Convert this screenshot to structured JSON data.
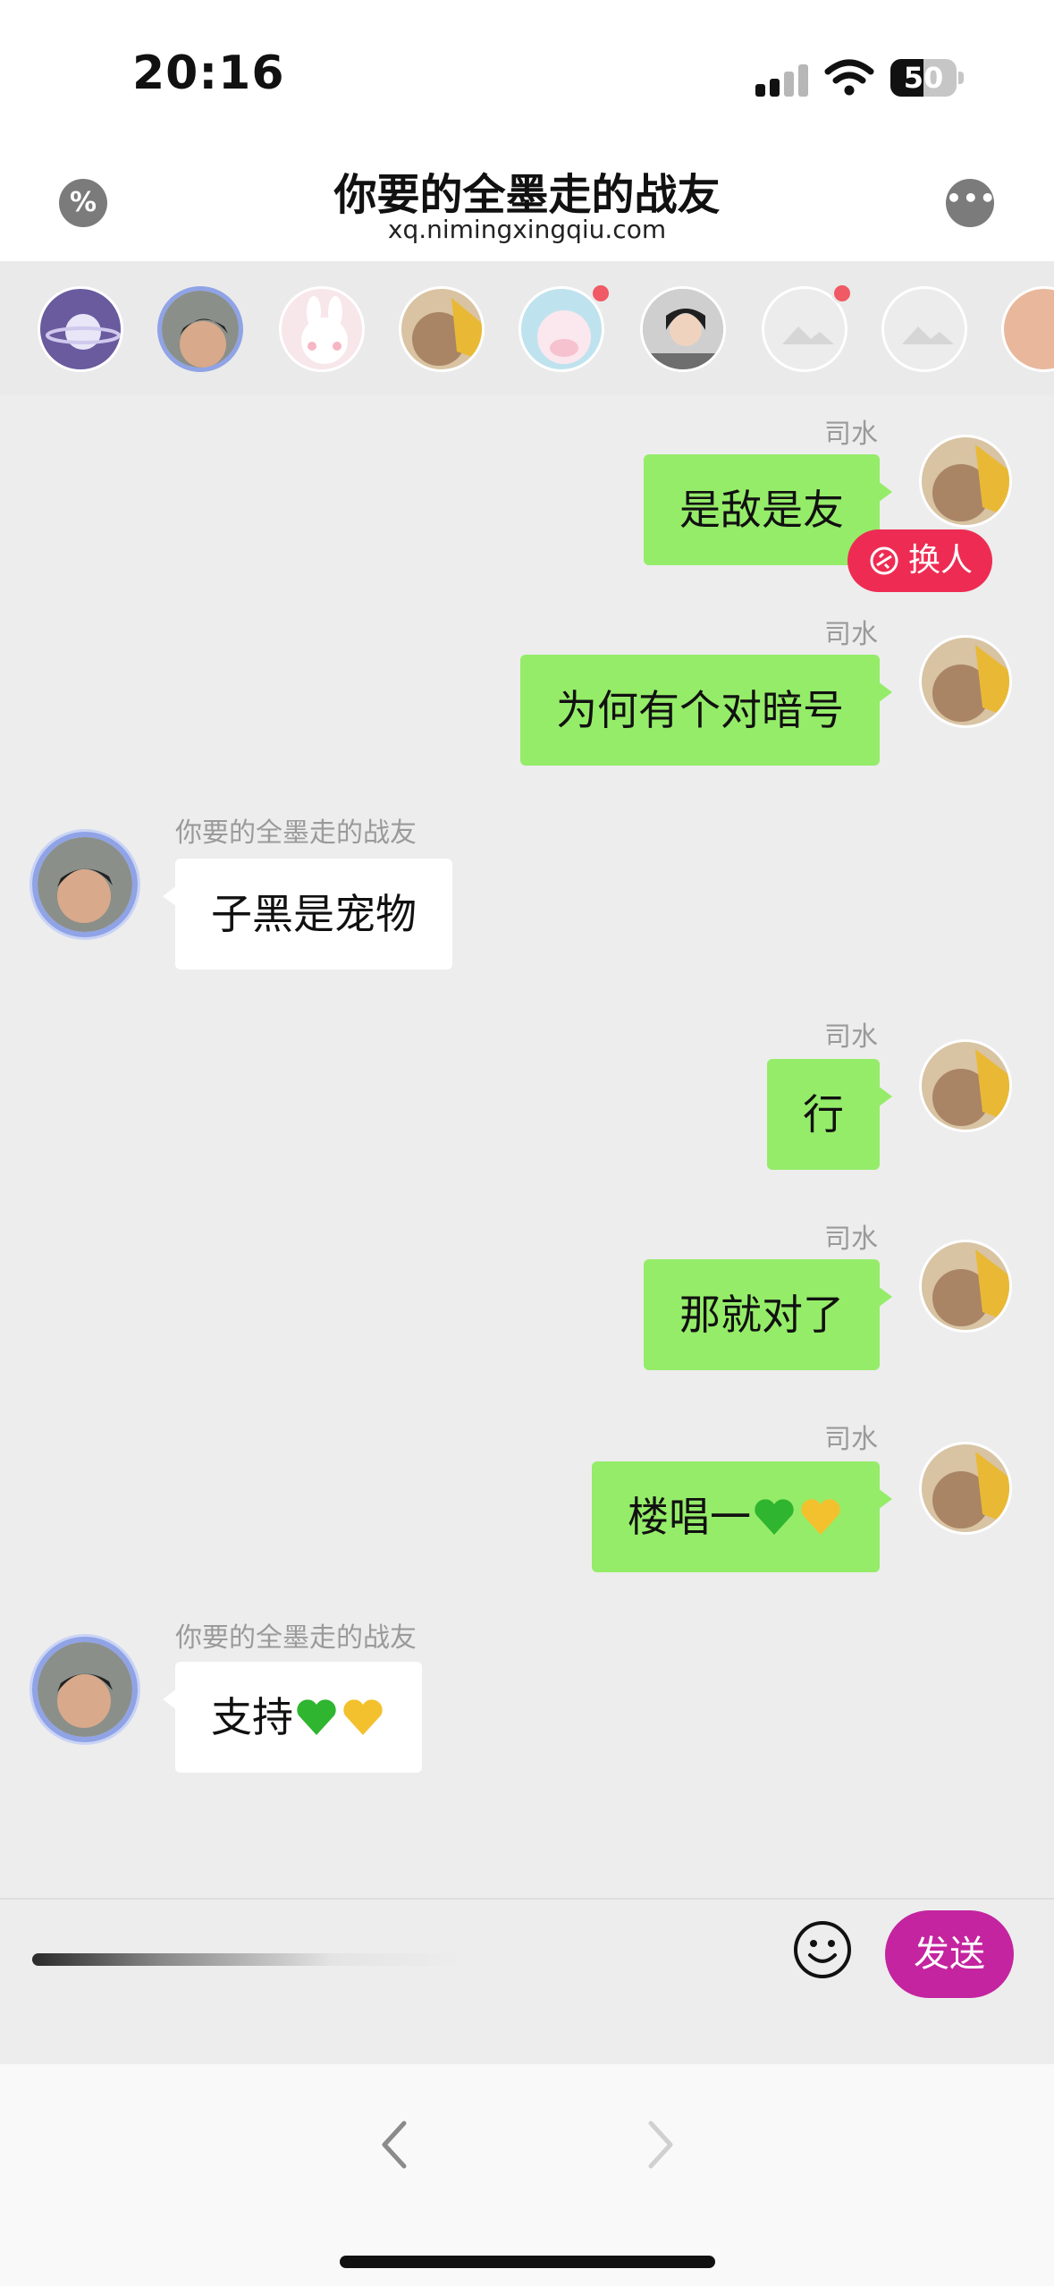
{
  "status": {
    "time": "20:16",
    "battery": "50",
    "battery_level": 0.5
  },
  "header": {
    "title": "你要的全墨走的战友",
    "subtitle": "xq.nimingxingqiu.com"
  },
  "strip": {
    "items": [
      {
        "name": "planet-avatar",
        "color": "#6a5a9e"
      },
      {
        "name": "boy-avatar",
        "color": "#8fa3e6"
      },
      {
        "name": "bunny-avatar",
        "color": "#f4dbe2"
      },
      {
        "name": "dog-avatar",
        "color": "#c9a57a"
      },
      {
        "name": "pig-avatar",
        "color": "#bfe3ee"
      },
      {
        "name": "girl-avatar",
        "color": "#9b9b9b"
      },
      {
        "name": "placeholder-avatar",
        "color": "#e4e4e4"
      },
      {
        "name": "placeholder-avatar-2",
        "color": "#e4e4e4"
      },
      {
        "name": "face-avatar",
        "color": "#e8b79c"
      }
    ]
  },
  "chat": {
    "messages": [
      {
        "sender": "司水",
        "text": "是敌是友",
        "mine": true
      },
      {
        "sender": "司水",
        "text": "为何有个对暗号",
        "mine": true
      },
      {
        "sender": "你要的全墨走的战友",
        "text": "子黑是宠物",
        "mine": false
      },
      {
        "sender": "司水",
        "text": "行",
        "mine": true
      },
      {
        "sender": "司水",
        "text": "那就对了",
        "mine": true
      },
      {
        "sender": "司水",
        "text": "楼唱一",
        "mine": true
      },
      {
        "sender": "你要的全墨走的战友",
        "text": "支持",
        "mine": false
      }
    ],
    "swap_label": "换人"
  },
  "composer": {
    "send_label": "发送"
  },
  "colors": {
    "my_bubble": "#95ec69",
    "their_bubble": "#ffffff",
    "send": "#c4249f",
    "swap": "#ee2c53"
  }
}
